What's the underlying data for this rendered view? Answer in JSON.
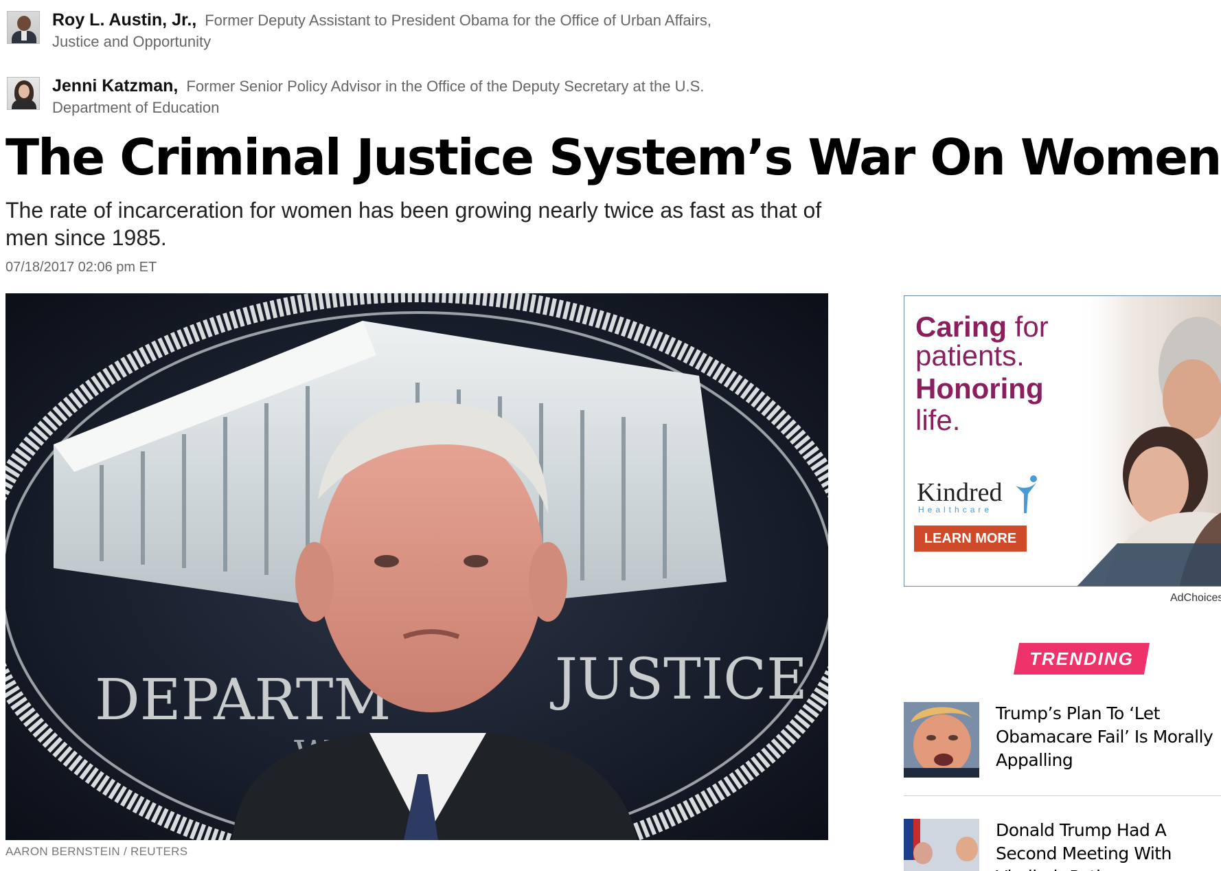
{
  "authors": [
    {
      "name": "Roy L. Austin, Jr.,",
      "role": "Former Deputy Assistant to President Obama for the Office of Urban Affairs, Justice and Opportunity"
    },
    {
      "name": "Jenni Katzman,",
      "role": "Former Senior Policy Advisor in the Office of the Deputy Secretary at the U.S. Department of Education"
    }
  ],
  "article": {
    "headline": "The Criminal Justice System’s War On Women",
    "dek": "The rate of incarceration for women has been growing nearly twice as fast as that of men since 1985.",
    "timestamp": "07/18/2017 02:06 pm ET",
    "image_caption": "AARON BERNSTEIN / REUTERS",
    "image_seal_text_1": "DEPARTM",
    "image_seal_text_2": "JUSTICE",
    "image_seal_text_3": "WAS"
  },
  "ad": {
    "line1_bold": "Caring",
    "line1_rest": " for",
    "line2": "patients.",
    "line3": "Honoring",
    "line4": "life.",
    "brand": "Kindred",
    "brand_sub": "Healthcare",
    "cta": "LEARN MORE",
    "adchoices": "AdChoices",
    "colors": {
      "accent": "#8a1f5e",
      "cta": "#cf4a29",
      "brand_blue": "#4a9bd4"
    }
  },
  "trending": {
    "label": "TRENDING",
    "color": "#f0326b",
    "stories": [
      {
        "title": "Trump’s Plan To ‘Let Obamacare Fail’ Is Morally Appalling"
      },
      {
        "title": "Donald Trump Had A Second Meeting With Vladimir Putin"
      }
    ]
  }
}
